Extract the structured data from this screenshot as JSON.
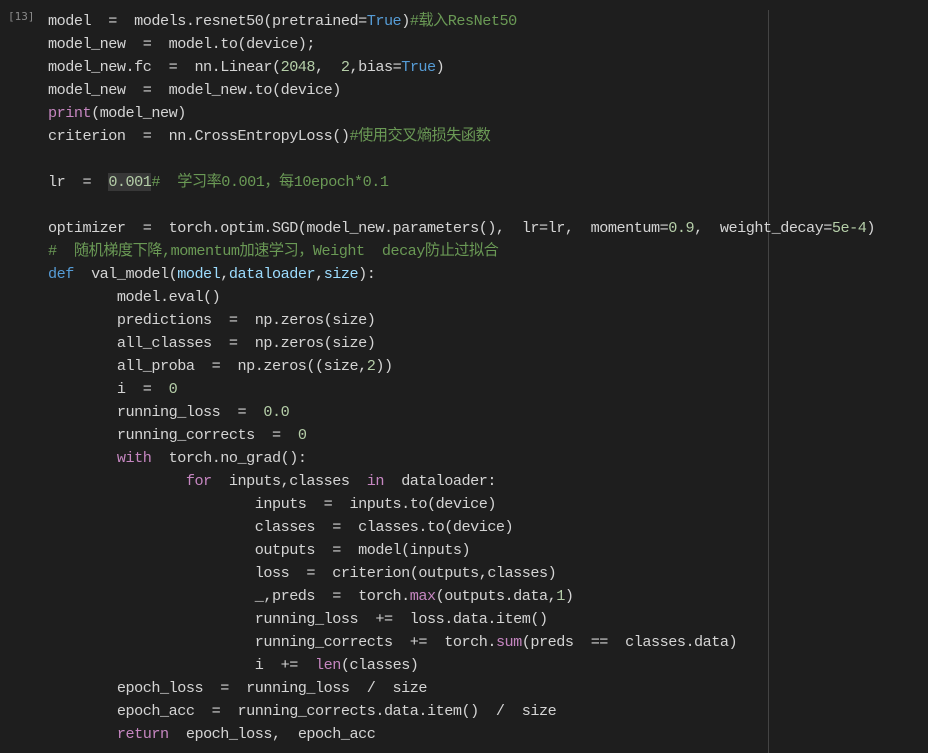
{
  "cell": {
    "execution_count": "[13]"
  },
  "colors": {
    "background": "#1e1e1e",
    "default": "#d4d4d4",
    "keyword": "#569cd6",
    "builtin": "#c586c0",
    "comment": "#6a9955",
    "number": "#b5cea8",
    "constant": "#569cd6",
    "param": "#9cdcfe",
    "func_call": "#d4d4d4"
  },
  "code_lines": [
    [
      {
        "t": "model  =  models.resnet50(pretrained="
      },
      {
        "t": "True",
        "c": "constant"
      },
      {
        "t": ")"
      },
      {
        "t": "#载入ResNet50",
        "c": "comment"
      }
    ],
    [
      {
        "t": "model_new  =  model.to(device);"
      }
    ],
    [
      {
        "t": "model_new.fc  =  nn.Linear("
      },
      {
        "t": "2048",
        "c": "number"
      },
      {
        "t": ",  "
      },
      {
        "t": "2",
        "c": "number"
      },
      {
        "t": ",bias="
      },
      {
        "t": "True",
        "c": "constant"
      },
      {
        "t": ")"
      }
    ],
    [
      {
        "t": "model_new  =  model_new.to(device)"
      }
    ],
    [
      {
        "t": "print",
        "c": "builtin"
      },
      {
        "t": "(model_new)"
      }
    ],
    [
      {
        "t": "criterion  =  nn.CrossEntropyLoss()"
      },
      {
        "t": "#使用交叉熵损失函数",
        "c": "comment"
      }
    ],
    [
      {
        "t": ""
      }
    ],
    [
      {
        "t": "lr  =  "
      },
      {
        "t": "0.001",
        "c": "number",
        "hl": true
      },
      {
        "t": "#  学习率0.001，每10epoch*0.1",
        "c": "comment"
      }
    ],
    [
      {
        "t": ""
      }
    ],
    [
      {
        "t": "optimizer  =  torch.optim.SGD(model_new.parameters(),  lr=lr,  momentum="
      },
      {
        "t": "0.9",
        "c": "number"
      },
      {
        "t": ",  weight_decay="
      },
      {
        "t": "5e-4",
        "c": "number"
      },
      {
        "t": ")"
      }
    ],
    [
      {
        "t": "#  随机梯度下降,momentum加速学习，Weight  decay防止过拟合",
        "c": "comment"
      }
    ],
    [
      {
        "t": "def",
        "c": "keyword"
      },
      {
        "t": "  val_model("
      },
      {
        "t": "model",
        "c": "param"
      },
      {
        "t": ","
      },
      {
        "t": "dataloader",
        "c": "param"
      },
      {
        "t": ","
      },
      {
        "t": "size",
        "c": "param"
      },
      {
        "t": "):"
      }
    ],
    [
      {
        "t": "        model.eval()"
      }
    ],
    [
      {
        "t": "        predictions  =  np.zeros(size)"
      }
    ],
    [
      {
        "t": "        all_classes  =  np.zeros(size)"
      }
    ],
    [
      {
        "t": "        all_proba  =  np.zeros((size,"
      },
      {
        "t": "2",
        "c": "number"
      },
      {
        "t": "))"
      }
    ],
    [
      {
        "t": "        i  =  "
      },
      {
        "t": "0",
        "c": "number"
      }
    ],
    [
      {
        "t": "        running_loss  =  "
      },
      {
        "t": "0.0",
        "c": "number"
      }
    ],
    [
      {
        "t": "        running_corrects  =  "
      },
      {
        "t": "0",
        "c": "number"
      }
    ],
    [
      {
        "t": "        "
      },
      {
        "t": "with",
        "c": "builtin"
      },
      {
        "t": "  torch.no_grad():"
      }
    ],
    [
      {
        "t": "                "
      },
      {
        "t": "for",
        "c": "builtin"
      },
      {
        "t": "  inputs,classes  "
      },
      {
        "t": "in",
        "c": "builtin"
      },
      {
        "t": "  dataloader:"
      }
    ],
    [
      {
        "t": "                        inputs  =  inputs.to(device)"
      }
    ],
    [
      {
        "t": "                        classes  =  classes.to(device)"
      }
    ],
    [
      {
        "t": "                        outputs  =  model(inputs)"
      }
    ],
    [
      {
        "t": "                        loss  =  criterion(outputs,classes)"
      }
    ],
    [
      {
        "t": "                        _,preds  =  torch."
      },
      {
        "t": "max",
        "c": "builtin"
      },
      {
        "t": "(outputs.data,"
      },
      {
        "t": "1",
        "c": "number"
      },
      {
        "t": ")"
      }
    ],
    [
      {
        "t": "                        running_loss  +=  loss.data.item()"
      }
    ],
    [
      {
        "t": "                        running_corrects  +=  torch."
      },
      {
        "t": "sum",
        "c": "builtin"
      },
      {
        "t": "(preds  ==  classes.data)"
      }
    ],
    [
      {
        "t": "                        i  +=  "
      },
      {
        "t": "len",
        "c": "builtin"
      },
      {
        "t": "(classes)"
      }
    ],
    [
      {
        "t": "        epoch_loss  =  running_loss  /  size"
      }
    ],
    [
      {
        "t": "        epoch_acc  =  running_corrects.data.item()  /  size"
      }
    ],
    [
      {
        "t": "        "
      },
      {
        "t": "return",
        "c": "builtin"
      },
      {
        "t": "  epoch_loss,  epoch_acc"
      }
    ]
  ]
}
